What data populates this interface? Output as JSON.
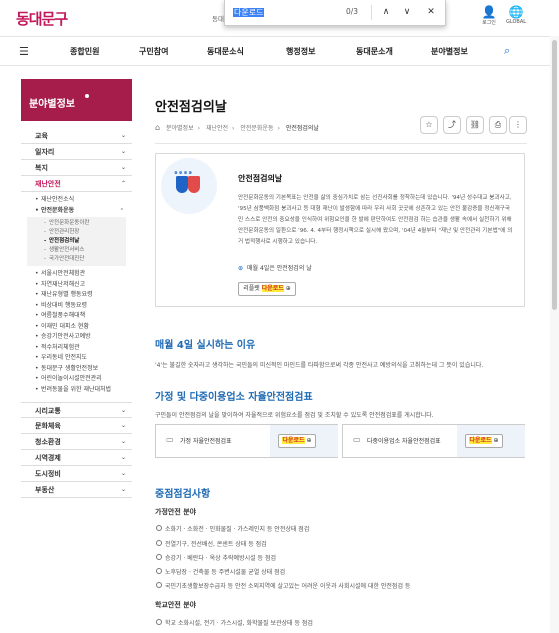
{
  "header": {
    "logo": "동대문구",
    "peek_text": "동대",
    "find_bar": {
      "query": "다운로드",
      "count": "0/3",
      "up": "∧",
      "down": "∨",
      "close": "✕"
    },
    "utils": [
      {
        "label": "로그인"
      },
      {
        "label": "GLOBAL"
      }
    ]
  },
  "gnb": {
    "items": [
      "종합민원",
      "구민참여",
      "동대문소식",
      "행정정보",
      "동대문소개",
      "분야별정보"
    ]
  },
  "lnb": {
    "title": "분야별정보",
    "menus": [
      {
        "label": "교육",
        "chev": "⌄"
      },
      {
        "label": "일자리",
        "chev": "⌄"
      },
      {
        "label": "복지",
        "chev": "⌄"
      },
      {
        "label": "재난안전",
        "chev": "⌃"
      }
    ],
    "disaster": {
      "sub1": "재난안전소식",
      "sub2": "안전문화운동",
      "sub2_chev": "⌃",
      "box": [
        "안전문화운동이란",
        "안전관리헌장",
        "안전점검의날",
        "생활안전서비스",
        "국가안전대진단"
      ],
      "rest": [
        "서울시안전체험관",
        "자연재난저해신고",
        "재난유형별 행동요령",
        "비상대비 행동요령",
        "여름철풍수해대책",
        "이재민 대피소 현황",
        "승강기안전사고예방",
        "적수처리체험관",
        "우리동네 안전지도",
        "동대문구 생활안전정보",
        "어린이놀이시설안전관리",
        "번려동물을 위한 재난대처법"
      ]
    },
    "menus2": [
      {
        "label": "시리교통",
        "chev": "⌄"
      },
      {
        "label": "문화체육",
        "chev": "⌄"
      },
      {
        "label": "청소환경",
        "chev": "⌄"
      },
      {
        "label": "시역경제",
        "chev": "⌄"
      },
      {
        "label": "도시정비",
        "chev": "⌄"
      },
      {
        "label": "부동산",
        "chev": "⌄"
      }
    ]
  },
  "page": {
    "title": "안전점검의날",
    "breadcrumb": [
      "분야별정보",
      "재난안전",
      "안전문화운동",
      "안전점검의날"
    ],
    "intro": {
      "heading": "안전점검의날",
      "desc": "안전문화운동의 기본목표는 안전을 삶의 중심가치로 삼는 선진사회를 정착하는데 있습니다. '94년 성수대교 붕괴사고, '95년 삼풍백화점 붕괴사고 등 대형 재난이 발생함에 따라 우리 사회 곳곳에 상존하고 있는 안전 불감증을 정신재구국민 스스로 안전의 중요성을 인식하여 위험요인을 한 발에 판단하여도 안전점검 하는 습관을 생활 속에서 실천하기 위해 안전문화운동의 일환으로 '96. 4. 4부터 행정시책으로 실시해 왔으며, '04년 4월부터 \"재난 및 안전관리 기본법\"에 의거 법적행사로 시행하고 있습니다.",
      "check_label": "매월 4일은 안전점검의 날",
      "leaflet_label": "리플렛",
      "download": "다운로드"
    },
    "sections": {
      "why_title": "매월 4일 실시하는 이유",
      "why_text": "'4'는 불길한 숫자라고 생각하는 국민들의 미신적인 마인드를 타파함으로써 각종 안전사고 예방의식을 고취하는데 그 뜻이 있습니다.",
      "selfcheck_title": "가정 및 다중이용업소 자율안전점검표",
      "selfcheck_text": "구민들이 안전점검의 날을 맞이하여 자율적으로 위험요소를 점검 및 조치할 수 있도록 안전점검표를 게시합니다.",
      "docs": [
        {
          "name": "가정 자율안전점검표",
          "download": "다운로드"
        },
        {
          "name": "다중이용업소 자율안전점검표",
          "download": "다운로드"
        }
      ],
      "focus_title": "중점점검사항",
      "living_title": "가정안전 분야",
      "living": [
        "소화기 · 소화전 · 인화물질 · 가스레인지 등 안전상태 점검",
        "전열기구, 전선배선, 콘센트 상태 등 점검",
        "승강기 · 베란다 · 옥상 추락예방시설 등 점검",
        "노후담장 · 건축물 등 주변시설물 균열 상태 점검",
        "국민기초생활보장수급자 등 안전 소외지역에 살고있는 어려운 이웃과 사회시설에 대한 안전점검 등"
      ],
      "school_title": "학교안전 분야",
      "school": [
        "학교 소화시설, 전기 · 가스시설, 화학물질 보관상태 등 점검"
      ]
    }
  }
}
